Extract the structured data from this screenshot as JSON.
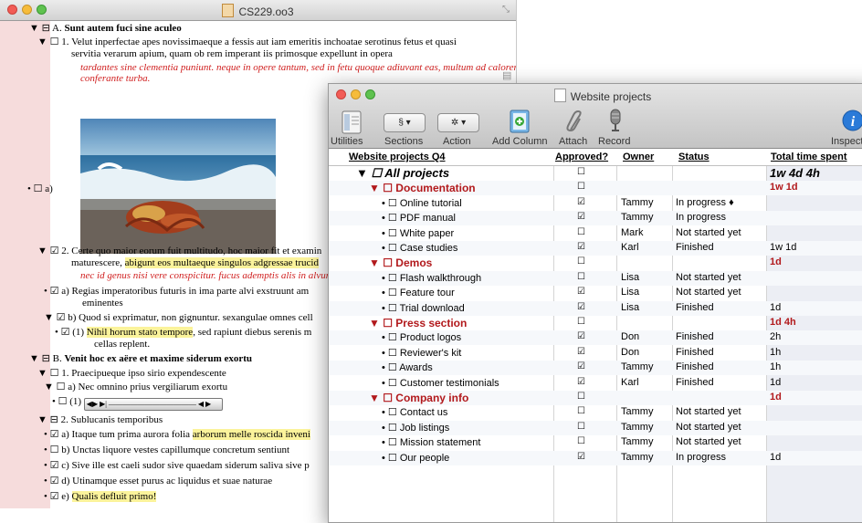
{
  "back_window": {
    "title": "CS229.oo3",
    "outline": [
      {
        "prefix": "▼ ⊟ A.",
        "text": "Sunt autem fuci sine aculeo",
        "bold": true
      },
      {
        "prefix": "▼ ☐ 1.",
        "text": "Velut inperfectae apes novissimaeque a fessis aut iam emeritis inchoatae serotinus fetus et quasi"
      },
      {
        "prefix": "",
        "text": "servitia verarum apium, quam ob rem imperant iis primosque expellunt in opera"
      },
      {
        "prefix": "",
        "text": "tardantes sine clementia puniunt. neque in opere tantum, sed in fetu quoque adiuvant eas, multum ad calorem",
        "note": true
      },
      {
        "prefix": "",
        "text": "conferante turba.",
        "note": true
      },
      {
        "prefix": "• ☐ a)",
        "text": ""
      },
      {
        "prefix": "▼ ☑ 2.",
        "text": "Certe quo maior eorum fuit multitudo, hoc maior fit et examin"
      },
      {
        "prefix": "",
        "text": "maturescere,",
        "highlight": "abigunt eos multaeque singulos adgressae trucid"
      },
      {
        "prefix": "",
        "text": "nec id genus nisi vere conspicitur. fucus ademptis alis in alvum rei",
        "note": true
      },
      {
        "prefix": "• ☑ a)",
        "text": "Regias imperatoribus futuris in ima parte alvi exstruunt am"
      },
      {
        "prefix": "",
        "text": "eminentes"
      },
      {
        "prefix": "▼ ☑ b)",
        "text": "Quod si exprimatur, non gignuntur. sexangulae omnes cell"
      },
      {
        "prefix": "• ☑ (1)",
        "highlight": "Nihil horum stato tempore",
        "text": ", sed rapiunt diebus serenis m"
      },
      {
        "prefix": "",
        "text": "cellas replent."
      },
      {
        "prefix": "▼ ⊟ B.",
        "text": "Venit hoc ex aëre et maxime siderum exortu",
        "bold": true
      },
      {
        "prefix": "▼ ☐ 1.",
        "text": "Praecipueque ipso sirio expendescente"
      },
      {
        "prefix": "▼ ☐ a)",
        "text": "Nec omnino prius vergiliarum exortu"
      },
      {
        "prefix": "• ☐ (1)",
        "text": ""
      },
      {
        "prefix": "▼ ⊟ 2.",
        "text": "Sublucanis temporibus"
      },
      {
        "prefix": "• ☑ a)",
        "text": "Itaque tum prima aurora folia",
        "highlight": "arborum melle roscida inveni"
      },
      {
        "prefix": "• ☐ b)",
        "text": "Unctas liquore vestes capillumque concretum sentiunt"
      },
      {
        "prefix": "• ☑ c)",
        "text": "Sive ille est caeli sudor sive quaedam siderum saliva sive p"
      },
      {
        "prefix": "• ☑ d)",
        "text": "Utinamque esset purus ac liquidus et suae naturae"
      },
      {
        "prefix": "• ☑ e)",
        "text": "",
        "highlight": "Qualis defluit primo!"
      }
    ]
  },
  "front_window": {
    "title": "Website projects",
    "toolbar": {
      "utilities": "Utilities",
      "sections": "Sections",
      "sections_btn": "§ ▾",
      "action": "Action",
      "action_btn": "✲ ▾",
      "add_column": "Add Column",
      "attach": "Attach",
      "record": "Record",
      "inspect": "Inspect"
    },
    "columns": [
      "Website projects Q4",
      "Approved?",
      "Owner",
      "Status",
      "Total time spent"
    ],
    "rows": [
      {
        "kind": "top",
        "name": "▼ ☐ All projects",
        "approved": "☐",
        "owner": "",
        "status": "",
        "time": "1w 4d 4h"
      },
      {
        "kind": "grp",
        "name": "▼ ☐ Documentation",
        "approved": "☐",
        "owner": "",
        "status": "",
        "time": "1w 1d"
      },
      {
        "kind": "item",
        "name": "• ☐ Online tutorial",
        "approved": "☑",
        "owner": "Tammy",
        "status": "In progress ♦",
        "time": ""
      },
      {
        "kind": "item",
        "name": "• ☐ PDF manual",
        "approved": "☑",
        "owner": "Tammy",
        "status": "In progress",
        "time": ""
      },
      {
        "kind": "item",
        "name": "• ☐ White paper",
        "approved": "☐",
        "owner": "Mark",
        "status": "Not started yet",
        "time": ""
      },
      {
        "kind": "item",
        "name": "• ☐ Case studies",
        "approved": "☑",
        "owner": "Karl",
        "status": "Finished",
        "time": "1w 1d"
      },
      {
        "kind": "grp",
        "name": "▼ ☐ Demos",
        "approved": "☐",
        "owner": "",
        "status": "",
        "time": "1d"
      },
      {
        "kind": "item",
        "name": "• ☐ Flash walkthrough",
        "approved": "☐",
        "owner": "Lisa",
        "status": "Not started yet",
        "time": ""
      },
      {
        "kind": "item",
        "name": "• ☐ Feature tour",
        "approved": "☑",
        "owner": "Lisa",
        "status": "Not started yet",
        "time": ""
      },
      {
        "kind": "item",
        "name": "• ☐ Trial download",
        "approved": "☑",
        "owner": "Lisa",
        "status": "Finished",
        "time": "1d"
      },
      {
        "kind": "grp",
        "name": "▼ ☐ Press section",
        "approved": "☐",
        "owner": "",
        "status": "",
        "time": "1d 4h"
      },
      {
        "kind": "item",
        "name": "• ☐ Product logos",
        "approved": "☑",
        "owner": "Don",
        "status": "Finished",
        "time": "2h"
      },
      {
        "kind": "item",
        "name": "• ☐ Reviewer's kit",
        "approved": "☑",
        "owner": "Don",
        "status": "Finished",
        "time": "1h"
      },
      {
        "kind": "item",
        "name": "• ☐ Awards",
        "approved": "☑",
        "owner": "Tammy",
        "status": "Finished",
        "time": "1h"
      },
      {
        "kind": "item",
        "name": "• ☐ Customer testimonials",
        "approved": "☑",
        "owner": "Karl",
        "status": "Finished",
        "time": "1d"
      },
      {
        "kind": "grp",
        "name": "▼ ☐ Company info",
        "approved": "☐",
        "owner": "",
        "status": "",
        "time": "1d"
      },
      {
        "kind": "item",
        "name": "• ☐ Contact us",
        "approved": "☐",
        "owner": "Tammy",
        "status": "Not started yet",
        "time": ""
      },
      {
        "kind": "item",
        "name": "• ☐ Job listings",
        "approved": "☐",
        "owner": "Tammy",
        "status": "Not started yet",
        "time": ""
      },
      {
        "kind": "item",
        "name": "• ☐ Mission statement",
        "approved": "☐",
        "owner": "Tammy",
        "status": "Not started yet",
        "time": ""
      },
      {
        "kind": "item",
        "name": "• ☐ Our people",
        "approved": "☑",
        "owner": "Tammy",
        "status": "In progress",
        "time": "1d"
      }
    ]
  },
  "icons": [
    "document-icon",
    "note-icon",
    "utilities-icon",
    "add-column-icon",
    "paperclip-icon",
    "microphone-icon",
    "info-icon",
    "media-player-icon"
  ],
  "colors": {
    "group_red": "#b2191c",
    "note_red": "#d02020",
    "highlight": "#fbf39b",
    "outline_strip": "#f6dcdc",
    "info_blue": "#2a7ad8"
  }
}
